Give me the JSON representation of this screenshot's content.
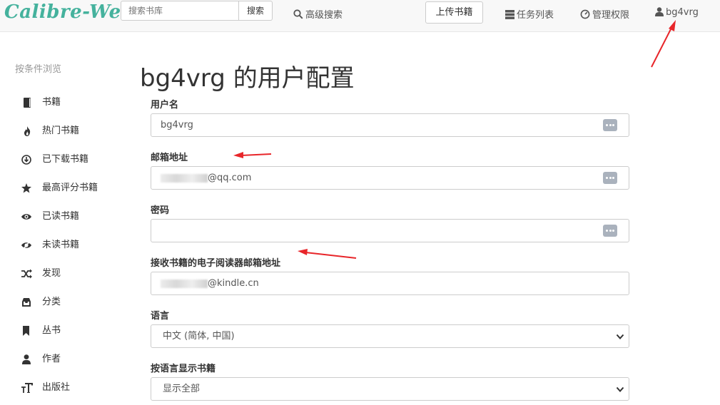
{
  "brand": "Calibre-Web",
  "search": {
    "placeholder": "搜索书库",
    "button": "搜索"
  },
  "nav": {
    "advanced_search": "高级搜索",
    "upload": "上传书籍",
    "tasks": "任务列表",
    "admin": "管理权限",
    "user": "bg4vrg"
  },
  "sidebar": {
    "title": "按条件浏览",
    "items": [
      {
        "label": "书籍",
        "icon": "book-icon"
      },
      {
        "label": "热门书籍",
        "icon": "fire-icon"
      },
      {
        "label": "已下载书籍",
        "icon": "download-circle-icon"
      },
      {
        "label": "最高评分书籍",
        "icon": "star-icon"
      },
      {
        "label": "已读书籍",
        "icon": "eye-open-icon"
      },
      {
        "label": "未读书籍",
        "icon": "eye-closed-icon"
      },
      {
        "label": "发现",
        "icon": "random-icon"
      },
      {
        "label": "分类",
        "icon": "inbox-icon"
      },
      {
        "label": "丛书",
        "icon": "bookmark-icon"
      },
      {
        "label": "作者",
        "icon": "user-icon"
      },
      {
        "label": "出版社",
        "icon": "text-size-icon"
      }
    ]
  },
  "page": {
    "title": "bg4vrg 的用户配置"
  },
  "form": {
    "username_label": "用户名",
    "username_value": "bg4vrg",
    "email_label": "邮箱地址",
    "email_value": "@qq.com",
    "password_label": "密码",
    "password_value": "",
    "kindle_label": "接收书籍的电子阅读器邮箱地址",
    "kindle_value": "@kindle.cn",
    "language_label": "语言",
    "language_value": "中文 (简体, 中国)",
    "book_language_label": "按语言显示书籍",
    "book_language_value": "显示全部"
  },
  "colors": {
    "brand": "#45b29d",
    "annotation_arrow": "#e8262a",
    "navbar_bg": "#f8f8f8"
  }
}
